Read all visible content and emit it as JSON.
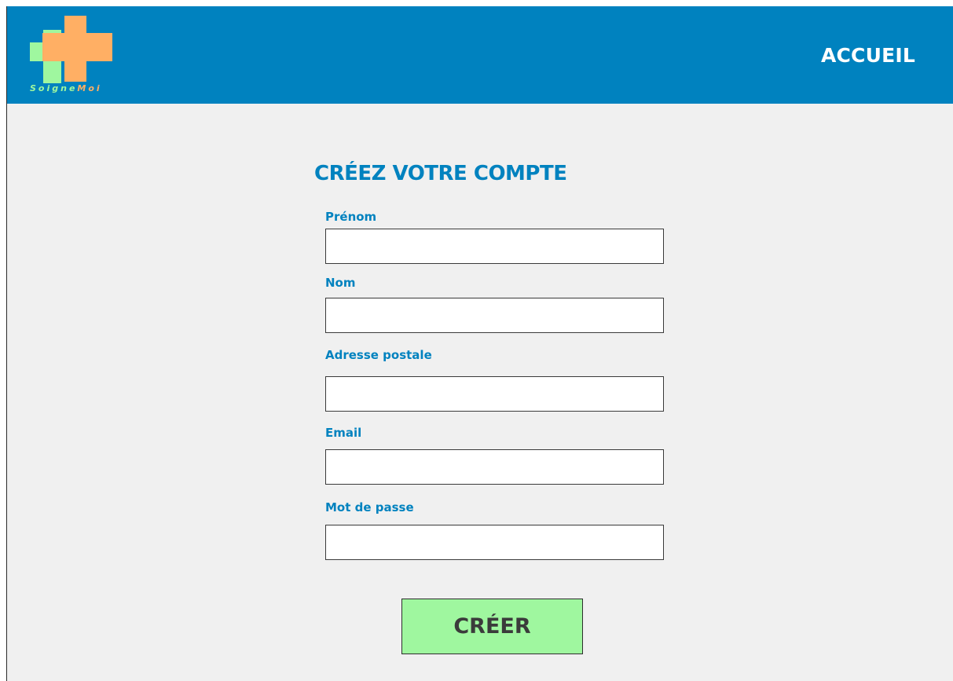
{
  "header": {
    "logo": {
      "name": "soignemoi-logo",
      "text_part1": "Soigne",
      "text_part2": "Moi",
      "colors": {
        "cross_back": "#9ff79f",
        "cross_front": "#ffaf64"
      }
    },
    "nav": {
      "home_label": "ACCUEIL"
    },
    "background": "#0082bf"
  },
  "form": {
    "title": "CRÉEZ VOTRE COMPTE",
    "fields": [
      {
        "label": "Prénom",
        "value": "",
        "placeholder": ""
      },
      {
        "label": "Nom",
        "value": "",
        "placeholder": ""
      },
      {
        "label": "Adresse postale",
        "value": "",
        "placeholder": ""
      },
      {
        "label": "Email",
        "value": "",
        "placeholder": ""
      },
      {
        "label": "Mot de passe",
        "value": "",
        "placeholder": ""
      }
    ],
    "submit_label": "CRÉER"
  },
  "colors": {
    "accent": "#0082bf",
    "button": "#9ff79f",
    "page_background": "#f0f0f0"
  }
}
